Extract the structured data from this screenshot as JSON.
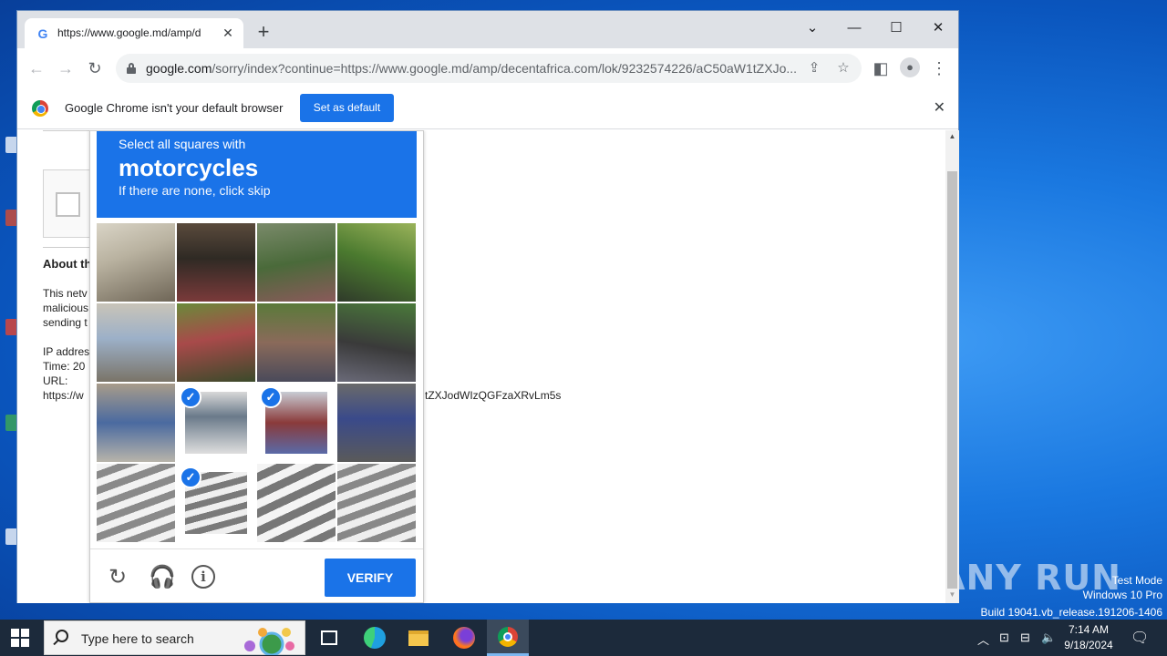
{
  "browser": {
    "tab_title": "https://www.google.md/amp/d",
    "tab_close": "✕",
    "new_tab": "+",
    "url_host": "google.com",
    "url_rest": "/sorry/index?continue=https://www.google.md/amp/decentafrica.com/lok/9232574226/aC50aW1tZXJo...",
    "infobar_text": "Google Chrome isn't your default browser",
    "set_default_label": "Set as default"
  },
  "page": {
    "about_heading": "About th",
    "line1": "This netv",
    "line2": "malicious",
    "line3": "sending t",
    "ip_label": "IP addres",
    "time_label": "Time: 20",
    "url_label": "URL:",
    "url_value": "https://w",
    "url_tail": "tZXJodWIzQGFzaXRvLm5s"
  },
  "captcha": {
    "instruction": "Select all squares with",
    "target": "motorcycles",
    "skip_hint": "If there are none, click skip",
    "verify_label": "VERIFY",
    "selected_tiles": [
      9,
      10,
      13
    ],
    "tick": "✓"
  },
  "desktop": {
    "watermark": "ANY RUN",
    "test_mode": "Test Mode",
    "os_name": "Windows 10 Pro",
    "build": "Build 19041.vb_release.191206-1406"
  },
  "taskbar": {
    "search_placeholder": "Type here to search",
    "time": "7:14 AM",
    "date": "9/18/2024"
  }
}
